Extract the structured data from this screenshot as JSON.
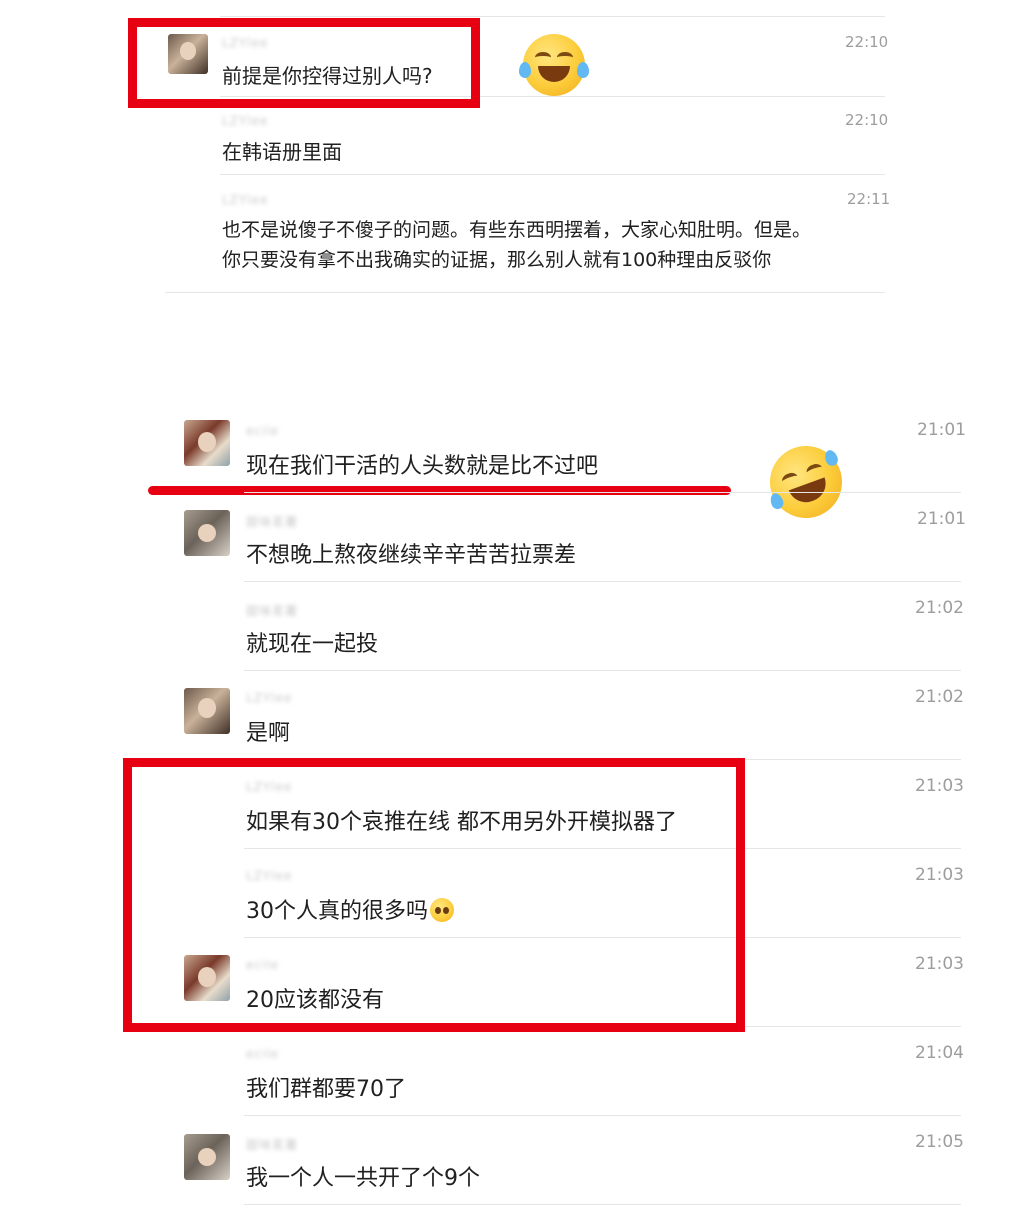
{
  "section1": {
    "messages": [
      {
        "sender": "LZYlee",
        "time": "22:10",
        "text": "前提是你控得过别人吗?"
      },
      {
        "sender": "LZYlee",
        "time": "22:10",
        "text": "在韩语册里面"
      },
      {
        "sender": "LZYlee",
        "time": "22:11",
        "lines": [
          "也不是说傻子不傻子的问题。有些东西明摆着，大家心知肚明。但是。",
          "你只要没有拿不出我确实的证据，那么别人就有100种理由反驳你"
        ]
      }
    ]
  },
  "section2": {
    "messages": [
      {
        "sender": "ecile",
        "time": "21:01",
        "text": "现在我们干活的人头数就是比不过吧"
      },
      {
        "sender": "甜味茗薯",
        "time": "21:01",
        "text": "不想晚上熬夜继续辛辛苦苦拉票差"
      },
      {
        "sender": "甜味茗薯",
        "time": "21:02",
        "text": "就现在一起投"
      },
      {
        "sender": "LZYlee",
        "time": "21:02",
        "text": "是啊"
      },
      {
        "sender": "LZYlee",
        "time": "21:03",
        "text": "如果有30个哀推在线 都不用另外开模拟器了"
      },
      {
        "sender": "LZYlee",
        "time": "21:03",
        "text": "30个人真的很多吗"
      },
      {
        "sender": "ecile",
        "time": "21:03",
        "text": "20应该都没有"
      },
      {
        "sender": "ecile",
        "time": "21:04",
        "text": "我们群都要70了"
      },
      {
        "sender": "甜味茗薯",
        "time": "21:05",
        "text": "我一个人一共开了个9个"
      }
    ]
  },
  "highlight_color": "#e60012",
  "icons": [
    "tears-of-joy-emoji",
    "rolling-laughing-emoji",
    "pleading-face-emoji"
  ]
}
